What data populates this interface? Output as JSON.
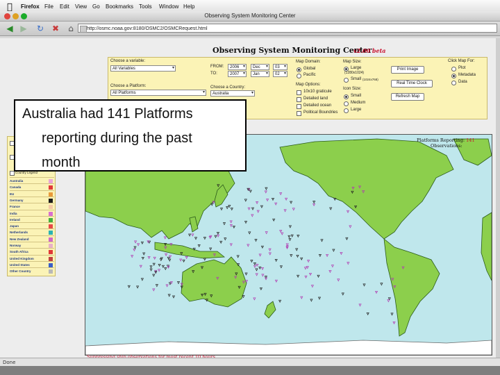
{
  "menubar": {
    "app": "Firefox",
    "items": [
      "File",
      "Edit",
      "View",
      "Go",
      "Bookmarks",
      "Tools",
      "Window",
      "Help"
    ]
  },
  "window": {
    "title": "Observing System Monitoring Center"
  },
  "toolbar": {
    "url": "http://osmc.noaa.gov:8180/OSMC2/OSMCRequest.html"
  },
  "page": {
    "title": "Observing System Monitoring Center",
    "version": "v2.00 beta",
    "variable": {
      "label": "Choose a variable:",
      "value": "All Variables"
    },
    "from": {
      "label": "FROM:",
      "year": "2006",
      "month": "Dec",
      "day": "03"
    },
    "to": {
      "label": "TO:",
      "year": "2007",
      "month": "Jan",
      "day": "02"
    },
    "platform": {
      "label": "Choose a Platform:",
      "value": "All Platforms"
    },
    "country": {
      "label": "Choose a Country:",
      "value": "Australia"
    },
    "map_domain": {
      "label": "Map Domain:",
      "options": [
        "Global",
        "Pacific"
      ],
      "selected": "Global"
    },
    "map_size": {
      "label": "Map Size:",
      "options": [
        "Large",
        "Small"
      ],
      "large_note": "(1280x1024)",
      "small_note": "(1024x768)",
      "selected": "Large"
    },
    "map_options": {
      "label": "Map Options:",
      "options": [
        "10x10 graticule",
        "Detailed land",
        "Detailed ocean",
        "Political Boundries"
      ]
    },
    "icon_size": {
      "label": "Icon Size:",
      "options": [
        "Small",
        "Medium",
        "Large"
      ],
      "selected": "Small"
    },
    "buttons": {
      "print": "Print Image",
      "clock": "Real Time Clock",
      "refresh": "Refresh Map"
    },
    "click_map": {
      "label": "Click Map For:",
      "options": [
        "Plot",
        "Metadata",
        "Data"
      ],
      "selected": "Metadata"
    },
    "legend": {
      "title": "Country Legend",
      "countries": [
        {
          "name": "Australia",
          "color": "#e8a6d8"
        },
        {
          "name": "Canada",
          "color": "#e13a3a"
        },
        {
          "name": "EU",
          "color": "#e89a3a"
        },
        {
          "name": "Germany",
          "color": "#1a1a1a"
        },
        {
          "name": "France",
          "color": "#f3c8a6"
        },
        {
          "name": "India",
          "color": "#d96fd0"
        },
        {
          "name": "Ireland",
          "color": "#40b040"
        },
        {
          "name": "Japan",
          "color": "#e84848"
        },
        {
          "name": "Netherlands",
          "color": "#2ab3b3"
        },
        {
          "name": "New Zealand",
          "color": "#d066c8"
        },
        {
          "name": "Norway",
          "color": "#e8b0c8"
        },
        {
          "name": "South Africa",
          "color": "#e03838"
        },
        {
          "name": "United Kingdom",
          "color": "#c04040"
        },
        {
          "name": "United States",
          "color": "#3a5fc8"
        },
        {
          "name": "Other Country",
          "color": "#b8b8b8"
        }
      ]
    },
    "map_header": {
      "platforms_label": "Platforms Reporting:",
      "platforms_value": "141",
      "observations_label": "Observations:"
    },
    "map_note": "Suppressing ship observations for most recent 10 hours"
  },
  "callout": {
    "lines": [
      "Australia had 141 Platforms",
      "reporting during the past",
      "month"
    ]
  },
  "statusbar": {
    "text": "Done"
  }
}
